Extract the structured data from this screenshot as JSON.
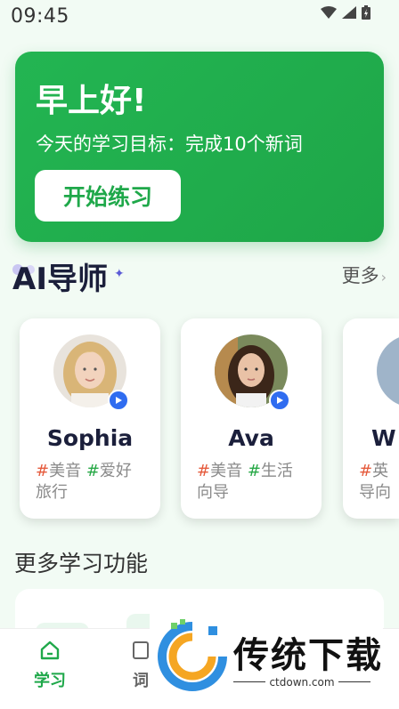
{
  "status_bar": {
    "time": "09:45"
  },
  "hero": {
    "greeting": "早上好!",
    "goal": "今天的学习目标：完成10个新词",
    "start_button": "开始练习"
  },
  "tutors_section": {
    "title": "AI导师",
    "more": "更多"
  },
  "tutors": [
    {
      "name": "Sophia",
      "tags_line1": [
        "美音",
        "爱好"
      ],
      "tags_line2": "旅行"
    },
    {
      "name": "Ava",
      "tags_line1": [
        "美音",
        "生活"
      ],
      "tags_line2": "向导"
    },
    {
      "name": "W",
      "tags_line1": [
        "英"
      ],
      "tags_line2": "导向"
    }
  ],
  "features_section": {
    "title": "更多学习功能"
  },
  "tabbar": {
    "tabs": [
      {
        "label": "学习",
        "active": true
      },
      {
        "label": "词",
        "active": false
      }
    ]
  },
  "watermark": {
    "brand": "传统下载",
    "url": "ctdown.com"
  },
  "colors": {
    "accent_green": "#1fa84a",
    "hash_red": "#e55a3c",
    "play_blue": "#2f6cf0"
  }
}
